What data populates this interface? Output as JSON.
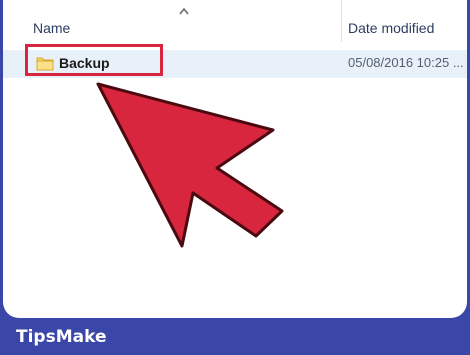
{
  "explorer": {
    "column_name": "Name",
    "column_date": "Date modified",
    "item": {
      "label": "Backup",
      "date_modified": "05/08/2016 10:25 ..."
    }
  },
  "watermark": "TipsMake",
  "footer": {
    "brand": "TipsMake"
  },
  "colors": {
    "highlight": "#d7263d",
    "arrow": "#d7263d",
    "footer_bg": "#3a46a8",
    "row_bg": "#e8f1fa"
  },
  "icons": [
    "sort-up-icon",
    "folder-icon",
    "pointer-arrow"
  ]
}
